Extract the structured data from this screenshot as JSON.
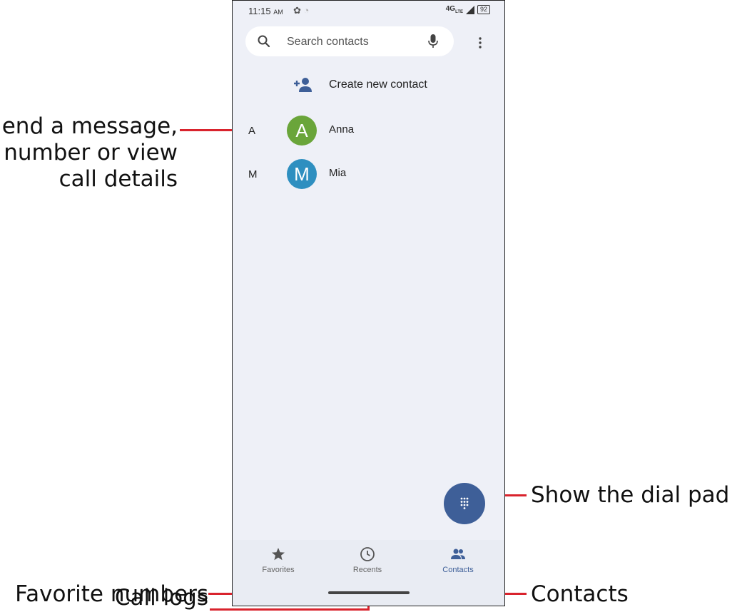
{
  "status": {
    "time": "11:15",
    "ampm": "AM",
    "network": "4G",
    "network_sub": "LTE",
    "battery": "92"
  },
  "search": {
    "placeholder": "Search contacts"
  },
  "create_contact": {
    "label": "Create new contact"
  },
  "contacts": [
    {
      "section": "A",
      "initial": "A",
      "name": "Anna",
      "avatar_color": "#6aa53a"
    },
    {
      "section": "M",
      "initial": "M",
      "name": "Mia",
      "avatar_color": "#2e8fc0"
    }
  ],
  "bottom_nav": [
    {
      "label": "Favorites",
      "icon": "star-icon",
      "active": false
    },
    {
      "label": "Recents",
      "icon": "clock-icon",
      "active": false
    },
    {
      "label": "Contacts",
      "icon": "people-icon",
      "active": true
    }
  ],
  "callouts": {
    "contact_line1": "end a message,",
    "contact_line2": "number or view",
    "contact_line3": "call details",
    "dial_pad": "Show the dial pad",
    "favorites": "Favorite numbers",
    "contacts": "Contacts",
    "call_logs": "Call logs"
  },
  "colors": {
    "accent": "#3e5f98",
    "callout_line": "#d9232d",
    "background": "#eef0f7"
  }
}
